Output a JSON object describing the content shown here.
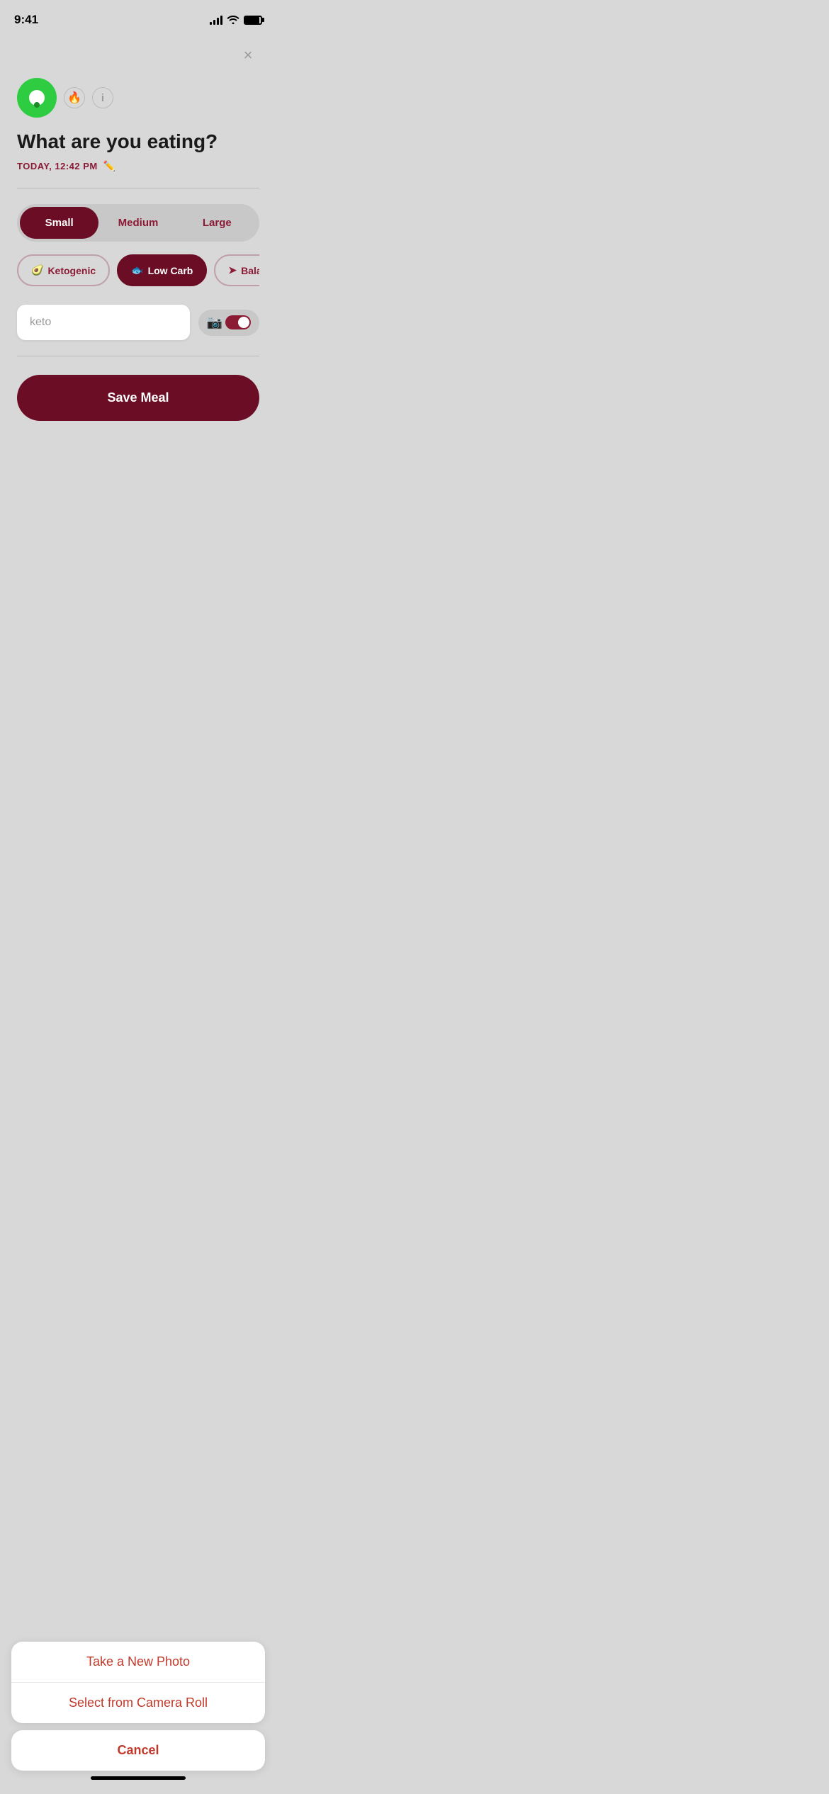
{
  "statusBar": {
    "time": "9:41"
  },
  "header": {
    "closeLabel": "×"
  },
  "logo": {
    "flameIcon": "🔥",
    "infoIcon": "i"
  },
  "page": {
    "title": "What are you eating?",
    "dateLabel": "TODAY, 12:42 PM",
    "editIcon": "✏️"
  },
  "sizeSelector": {
    "options": [
      {
        "label": "Small",
        "active": true
      },
      {
        "label": "Medium",
        "active": false
      },
      {
        "label": "Large",
        "active": false
      }
    ]
  },
  "dietSelector": {
    "options": [
      {
        "label": "Ketogenic",
        "icon": "🥑",
        "active": false
      },
      {
        "label": "Low Carb",
        "icon": "🐟",
        "active": true
      },
      {
        "label": "Balanced",
        "icon": "➤",
        "active": false
      }
    ]
  },
  "searchInput": {
    "value": "keto",
    "placeholder": "keto"
  },
  "saveMealBtn": {
    "label": "Save Meal"
  },
  "actionSheet": {
    "options": [
      {
        "label": "Take a New Photo"
      },
      {
        "label": "Select from Camera Roll"
      }
    ],
    "cancelLabel": "Cancel"
  }
}
